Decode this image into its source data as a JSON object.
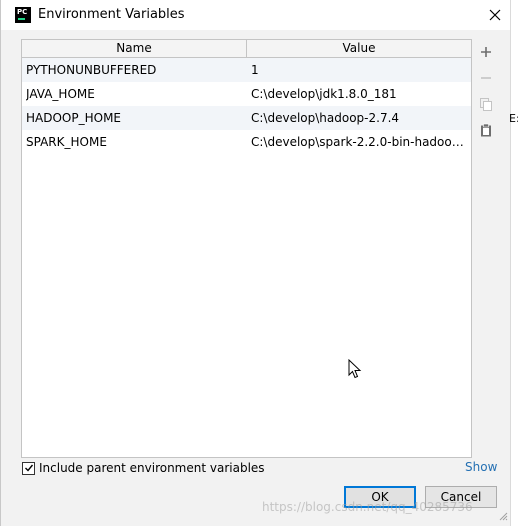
{
  "window": {
    "title": "Environment Variables",
    "app_icon_text": "PC"
  },
  "table": {
    "columns": {
      "name": "Name",
      "value": "Value"
    },
    "rows": [
      {
        "name": "PYTHONUNBUFFERED",
        "value": "1"
      },
      {
        "name": "JAVA_HOME",
        "value": "C:\\develop\\jdk1.8.0_181"
      },
      {
        "name": "HADOOP_HOME",
        "value": "C:\\develop\\hadoop-2.7.4"
      },
      {
        "name": "SPARK_HOME",
        "value": "C:\\develop\\spark-2.2.0-bin-hadoop..."
      }
    ]
  },
  "toolbar": {
    "add_icon": "plus-icon",
    "remove_icon": "minus-icon",
    "copy_icon": "copy-icon",
    "paste_icon": "paste-icon"
  },
  "footer": {
    "include_parent_label": "Include parent environment variables",
    "include_parent_checked": true,
    "show_link": "Show",
    "ok_label": "OK",
    "cancel_label": "Cancel"
  },
  "background": {
    "partial_text": "E:",
    "watermark": "https://blog.csdn.net/qq_40285736"
  },
  "colors": {
    "link": "#2470b3",
    "default_button_border": "#0078d7",
    "alt_row": "#f2f5f9"
  }
}
